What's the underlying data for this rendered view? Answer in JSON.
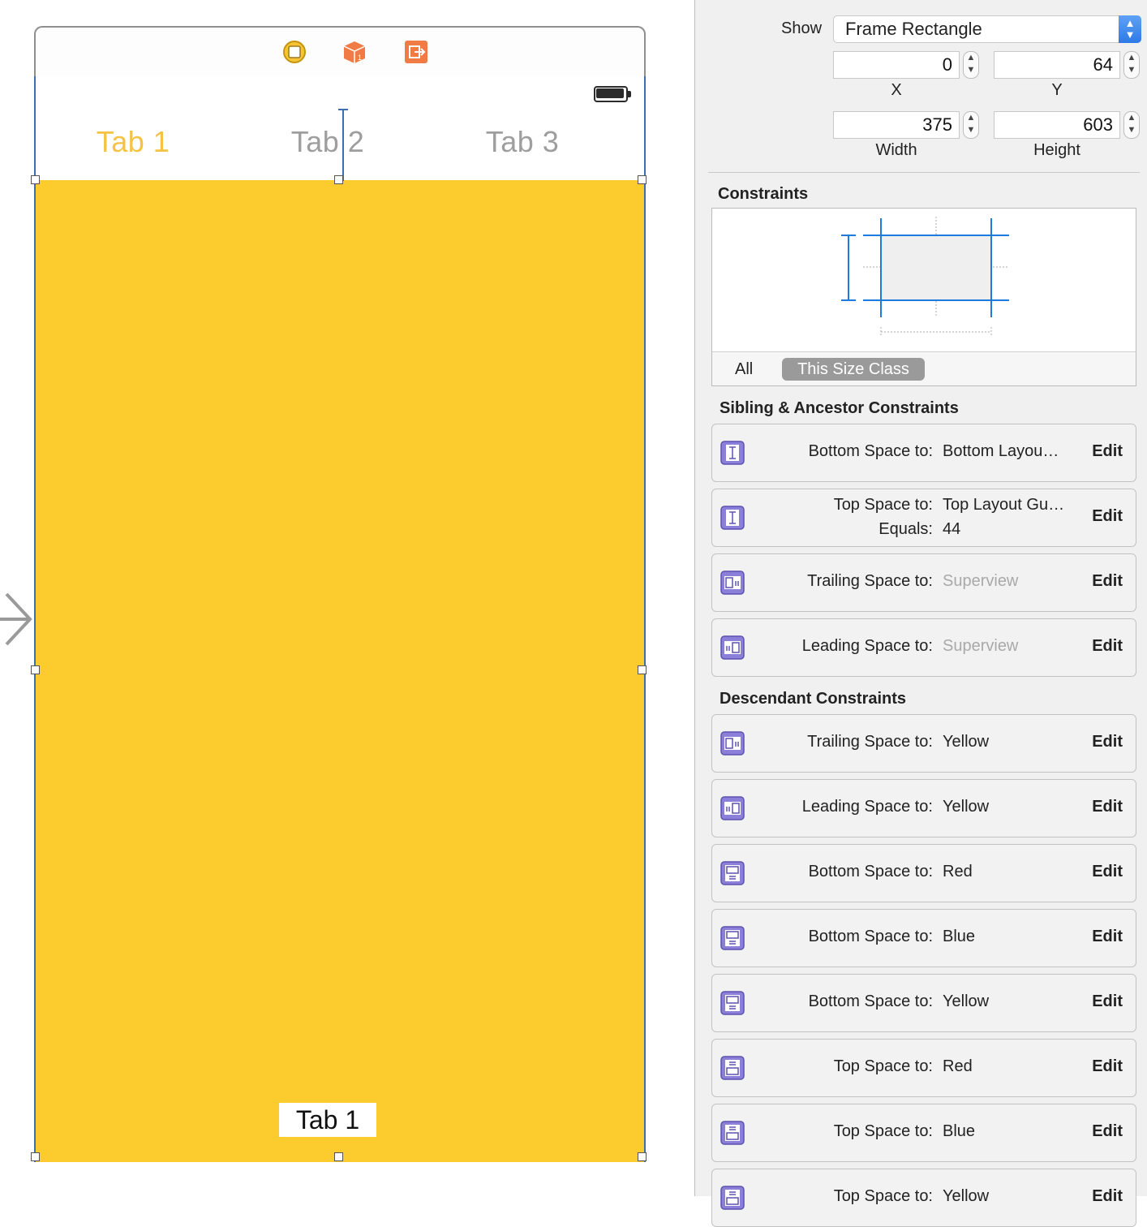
{
  "scene": {
    "tabs": [
      {
        "label": "Tab 1",
        "active": true
      },
      {
        "label": "Tab 2",
        "active": false
      },
      {
        "label": "Tab 3",
        "active": false
      }
    ],
    "content_label": "Tab 1",
    "colors": {
      "content": "#fccb2d",
      "active_tab": "#f4c343",
      "inactive_tab": "#9e9e9e",
      "selection": "#3d6fae"
    },
    "dock_icons": [
      "view-controller-icon",
      "first-responder-icon",
      "exit-icon"
    ]
  },
  "inspector": {
    "show_label": "Show",
    "show_value": "Frame Rectangle",
    "frame": {
      "x": {
        "value": "0",
        "caption": "X"
      },
      "y": {
        "value": "64",
        "caption": "Y"
      },
      "width": {
        "value": "375",
        "caption": "Width"
      },
      "height": {
        "value": "603",
        "caption": "Height"
      }
    },
    "constraints_title": "Constraints",
    "size_class": {
      "all": "All",
      "this": "This Size Class"
    },
    "sibling_title": "Sibling & Ancestor Constraints",
    "sibling": [
      {
        "icon": "vertical-space-icon",
        "label": "Bottom Space to:",
        "value": "Bottom Layou…",
        "dim": false,
        "edit": "Edit"
      },
      {
        "icon": "vertical-space-icon",
        "label": "Top Space to:",
        "value": "Top Layout Gu…",
        "dim": false,
        "label2": "Equals:",
        "value2": "44",
        "edit": "Edit"
      },
      {
        "icon": "trailing-space-icon",
        "label": "Trailing Space to:",
        "value": "Superview",
        "dim": true,
        "edit": "Edit"
      },
      {
        "icon": "leading-space-icon",
        "label": "Leading Space to:",
        "value": "Superview",
        "dim": true,
        "edit": "Edit"
      }
    ],
    "descendant_title": "Descendant Constraints",
    "descendant": [
      {
        "icon": "trailing-space-icon",
        "label": "Trailing Space to:",
        "value": "Yellow",
        "edit": "Edit"
      },
      {
        "icon": "leading-space-icon",
        "label": "Leading Space to:",
        "value": "Yellow",
        "edit": "Edit"
      },
      {
        "icon": "bottom-space-icon",
        "label": "Bottom Space to:",
        "value": "Red",
        "edit": "Edit"
      },
      {
        "icon": "bottom-space-icon",
        "label": "Bottom Space to:",
        "value": "Blue",
        "edit": "Edit"
      },
      {
        "icon": "bottom-space-icon",
        "label": "Bottom Space to:",
        "value": "Yellow",
        "edit": "Edit"
      },
      {
        "icon": "top-space-icon",
        "label": "Top Space to:",
        "value": "Red",
        "edit": "Edit"
      },
      {
        "icon": "top-space-icon",
        "label": "Top Space to:",
        "value": "Blue",
        "edit": "Edit"
      },
      {
        "icon": "top-space-icon",
        "label": "Top Space to:",
        "value": "Yellow",
        "edit": "Edit"
      }
    ]
  }
}
